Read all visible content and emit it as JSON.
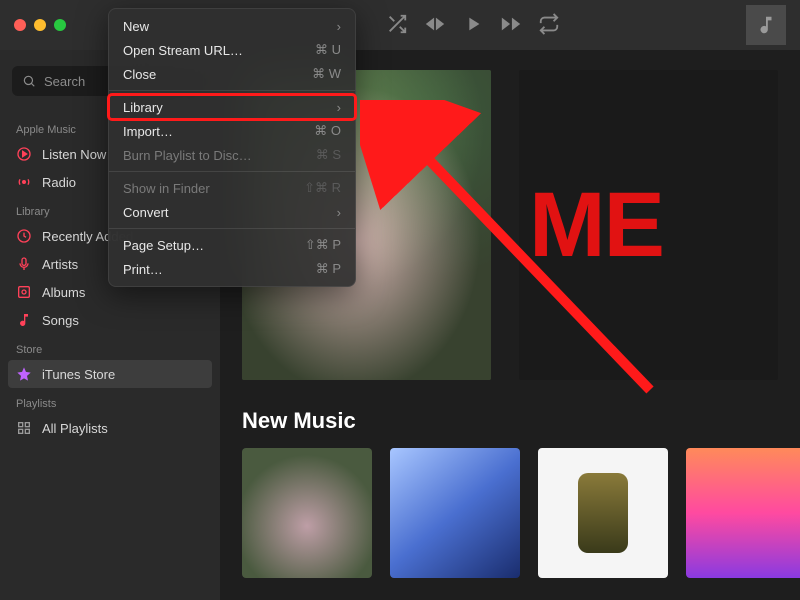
{
  "titlebar": {
    "nowplaying_icon": "music-note"
  },
  "sidebar": {
    "search_placeholder": "Search",
    "sections": [
      {
        "header": "Apple Music",
        "items": [
          {
            "label": "Listen Now",
            "icon": "play-circle",
            "color": "red"
          },
          {
            "label": "Radio",
            "icon": "radio",
            "color": "red"
          }
        ]
      },
      {
        "header": "Library",
        "items": [
          {
            "label": "Recently Added",
            "icon": "clock",
            "color": "red"
          },
          {
            "label": "Artists",
            "icon": "mic",
            "color": "red"
          },
          {
            "label": "Albums",
            "icon": "album",
            "color": "red"
          },
          {
            "label": "Songs",
            "icon": "note",
            "color": "red"
          }
        ]
      },
      {
        "header": "Store",
        "items": [
          {
            "label": "iTunes Store",
            "icon": "star",
            "color": "purple",
            "selected": true
          }
        ]
      },
      {
        "header": "Playlists",
        "items": [
          {
            "label": "All Playlists",
            "icon": "grid",
            "color": "gray"
          }
        ]
      }
    ]
  },
  "menu": {
    "items": [
      {
        "label": "New",
        "submenu": true
      },
      {
        "label": "Open Stream URL…",
        "shortcut": "⌘ U"
      },
      {
        "label": "Close",
        "shortcut": "⌘ W"
      },
      {
        "sep": true
      },
      {
        "label": "Library",
        "submenu": true,
        "highlighted": true
      },
      {
        "label": "Import…",
        "shortcut": "⌘ O"
      },
      {
        "label": "Burn Playlist to Disc…",
        "shortcut": "⌘ S",
        "disabled": true
      },
      {
        "sep": true
      },
      {
        "label": "Show in Finder",
        "shortcut": "⇧⌘ R",
        "disabled": true
      },
      {
        "label": "Convert",
        "submenu": true
      },
      {
        "sep": true
      },
      {
        "label": "Page Setup…",
        "shortcut": "⇧⌘ P"
      },
      {
        "label": "Print…",
        "shortcut": "⌘ P"
      }
    ]
  },
  "main": {
    "hero_right_text": "ME",
    "section_title": "New Music"
  }
}
